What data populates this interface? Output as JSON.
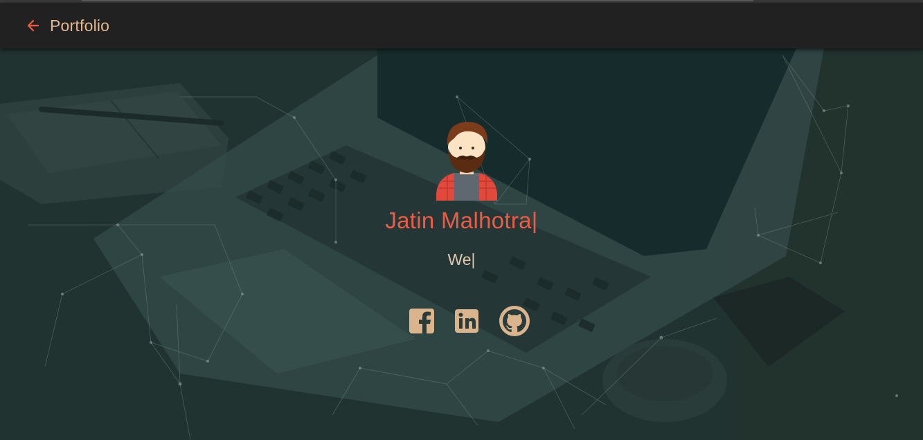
{
  "appbar": {
    "back_icon": "arrow-left-icon",
    "title": "Portfolio",
    "accent_color": "#ee5c45",
    "title_color": "#e3b98e",
    "background": "#212121"
  },
  "hero": {
    "avatar_icon": "bearded-man-avatar",
    "name": "Jatin Malhotra",
    "tagline": "We",
    "caret": "|",
    "name_color": "#ee5c45",
    "tagline_color": "#e0c8ad",
    "socials": [
      {
        "icon": "facebook-icon"
      },
      {
        "icon": "linkedin-icon"
      },
      {
        "icon": "github-icon"
      }
    ],
    "social_color": "#d9b48c"
  }
}
